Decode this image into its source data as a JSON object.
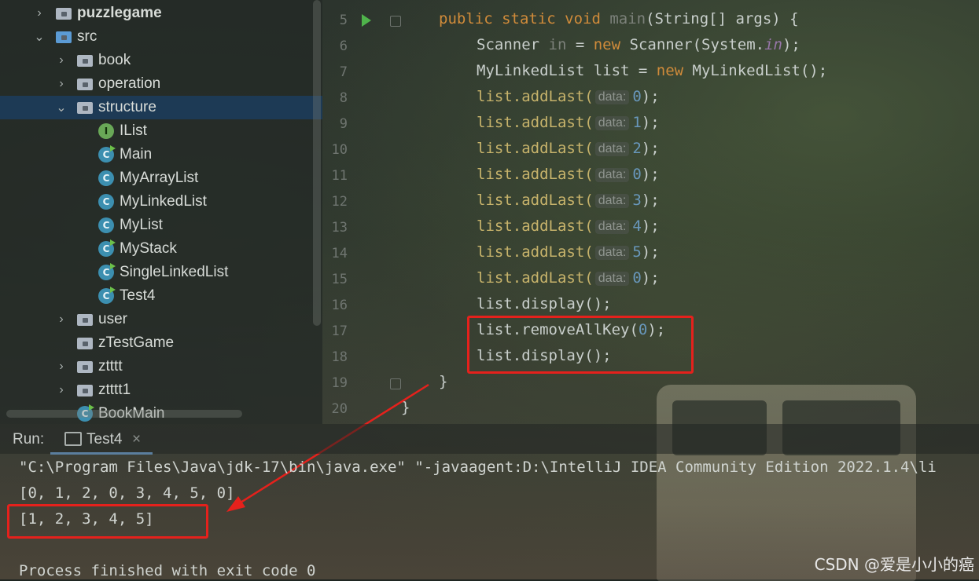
{
  "project_tree": {
    "items": [
      {
        "label": "puzzlegame",
        "kind": "module",
        "chevron": "collapsed"
      },
      {
        "label": "src",
        "kind": "source-folder",
        "chevron": "expanded"
      },
      {
        "label": "book",
        "kind": "package",
        "chevron": "collapsed"
      },
      {
        "label": "operation",
        "kind": "package",
        "chevron": "collapsed"
      },
      {
        "label": "structure",
        "kind": "package",
        "chevron": "expanded",
        "selected": true
      },
      {
        "label": "IList",
        "kind": "interface",
        "icon_letter": "I"
      },
      {
        "label": "Main",
        "kind": "class-runnable",
        "icon_letter": "C"
      },
      {
        "label": "MyArrayList",
        "kind": "class",
        "icon_letter": "C"
      },
      {
        "label": "MyLinkedList",
        "kind": "class",
        "icon_letter": "C"
      },
      {
        "label": "MyList",
        "kind": "class",
        "icon_letter": "C"
      },
      {
        "label": "MyStack",
        "kind": "class-runnable",
        "icon_letter": "C"
      },
      {
        "label": "SingleLinkedList",
        "kind": "class-runnable",
        "icon_letter": "C"
      },
      {
        "label": "Test4",
        "kind": "class-runnable",
        "icon_letter": "C"
      },
      {
        "label": "user",
        "kind": "package",
        "chevron": "collapsed"
      },
      {
        "label": "zTestGame",
        "kind": "package"
      },
      {
        "label": "ztttt",
        "kind": "package",
        "chevron": "collapsed"
      },
      {
        "label": "ztttt1",
        "kind": "package",
        "chevron": "collapsed"
      },
      {
        "label": "BookMain",
        "kind": "class-runnable",
        "icon_letter": "C"
      }
    ]
  },
  "editor": {
    "line_numbers": [
      "5",
      "6",
      "7",
      "8",
      "9",
      "10",
      "11",
      "12",
      "13",
      "14",
      "15",
      "16",
      "17",
      "18",
      "19",
      "20"
    ],
    "line5": {
      "kw": "public static void ",
      "name": "main",
      "rest": "(String[] args) {"
    },
    "line6": {
      "a": "Scanner ",
      "b": "in",
      "c": " = ",
      "d": "new",
      "e": " Scanner(System.",
      "f": "in",
      "g": ");"
    },
    "line7": {
      "a": "MyLinkedList list = ",
      "b": "new",
      "c": " MyLinkedList();"
    },
    "add_calls": [
      {
        "call": "list.addLast(",
        "hint": "data:",
        "value": "0",
        "end": ");"
      },
      {
        "call": "list.addLast(",
        "hint": "data:",
        "value": "1",
        "end": ");"
      },
      {
        "call": "list.addLast(",
        "hint": "data:",
        "value": "2",
        "end": ");"
      },
      {
        "call": "list.addLast(",
        "hint": "data:",
        "value": "0",
        "end": ");"
      },
      {
        "call": "list.addLast(",
        "hint": "data:",
        "value": "3",
        "end": ");"
      },
      {
        "call": "list.addLast(",
        "hint": "data:",
        "value": "4",
        "end": ");"
      },
      {
        "call": "list.addLast(",
        "hint": "data:",
        "value": "5",
        "end": ");"
      },
      {
        "call": "list.addLast(",
        "hint": "data:",
        "value": "0",
        "end": ");"
      }
    ],
    "line16": "list.display();",
    "line17": {
      "a": "list.removeAllKey(",
      "b": "0",
      "c": ");"
    },
    "line18": "list.display();",
    "line19": "}",
    "line20": "}"
  },
  "run_panel": {
    "label": "Run:",
    "tab_label": "Test4",
    "tab_close": "×",
    "console": [
      "\"C:\\Program Files\\Java\\jdk-17\\bin\\java.exe\" \"-javaagent:D:\\IntelliJ IDEA Community Edition 2022.1.4\\li",
      "[0, 1, 2, 0, 3, 4, 5, 0]",
      "[1, 2, 3, 4, 5]",
      "",
      "Process finished with exit code 0"
    ]
  },
  "watermark": "CSDN @爱是小小的癌",
  "colors": {
    "selection": "#1d3a55",
    "annotation_red": "#e5211c",
    "keyword": "#d08b3a",
    "number": "#6897bb"
  }
}
